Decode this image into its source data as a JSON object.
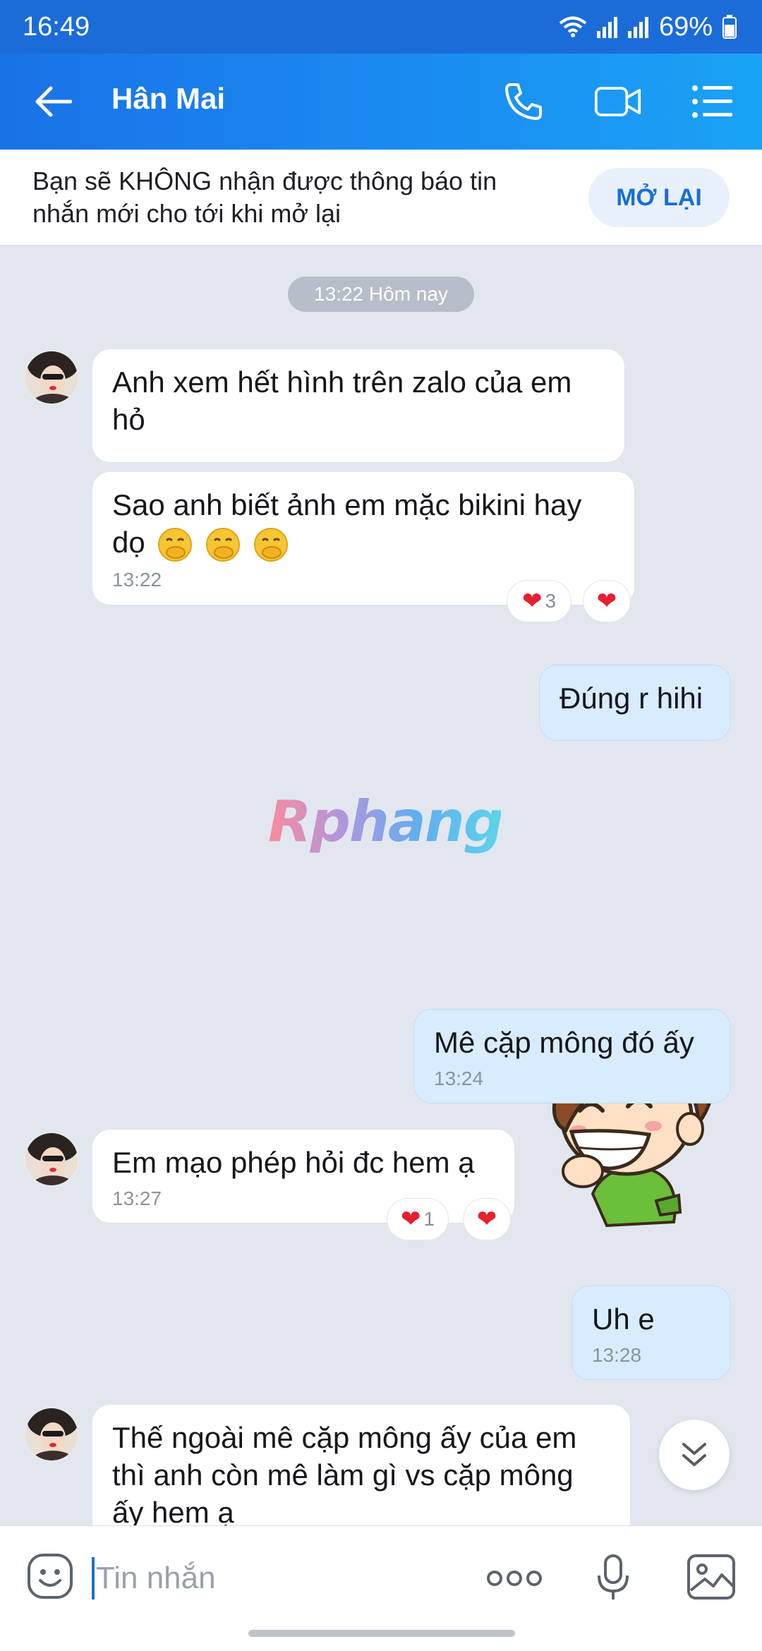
{
  "status_bar": {
    "time": "16:49",
    "battery": "69%"
  },
  "header": {
    "contact_name": "Hân Mai"
  },
  "mute_banner": {
    "line1": "Bạn sẽ KHÔNG nhận được thông báo tin",
    "line2": "nhắn mới cho tới khi mở lại",
    "button_label": "MỞ LẠI"
  },
  "chat": {
    "date_label": "13:22 Hôm nay",
    "watermark": "Rphang",
    "messages": [
      {
        "side": "in",
        "line1": "Anh xem hết hình trên zalo của em",
        "line2": "hỏ"
      },
      {
        "side": "in",
        "line1": "Sao anh biết ảnh em mặc bikini hay",
        "line2": "dọ",
        "emoji_count": 3,
        "time": "13:22",
        "reaction_count": "3"
      },
      {
        "side": "out",
        "text": "Đúng r hihi"
      },
      {
        "side": "out",
        "type": "sticker"
      },
      {
        "side": "out",
        "text": "Mê cặp mông đó ấy",
        "time": "13:24"
      },
      {
        "side": "in",
        "text": "Em mạo phép hỏi đc hem ạ",
        "time": "13:27",
        "reaction_count": "1"
      },
      {
        "side": "out",
        "text": "Uh e",
        "time": "13:28"
      },
      {
        "side": "in",
        "line1": "Thế ngoài mê cặp mông ấy của em",
        "line2": "thì anh còn mê làm gì vs cặp mông",
        "line3": "ấy hem ạ"
      }
    ]
  },
  "composer": {
    "placeholder": "Tin nhắn"
  },
  "colors": {
    "header_blue": "#1a8ef2",
    "status_blue": "#1b6cd8",
    "heart_red": "#e5202f",
    "outgoing_bubble": "#d8ecfd"
  },
  "icons": [
    "back-arrow-icon",
    "phone-icon",
    "video-call-icon",
    "menu-list-icon",
    "smiley-icon",
    "more-dots-icon",
    "microphone-icon",
    "image-gallery-icon",
    "chevron-down-icon",
    "heart-icon"
  ]
}
